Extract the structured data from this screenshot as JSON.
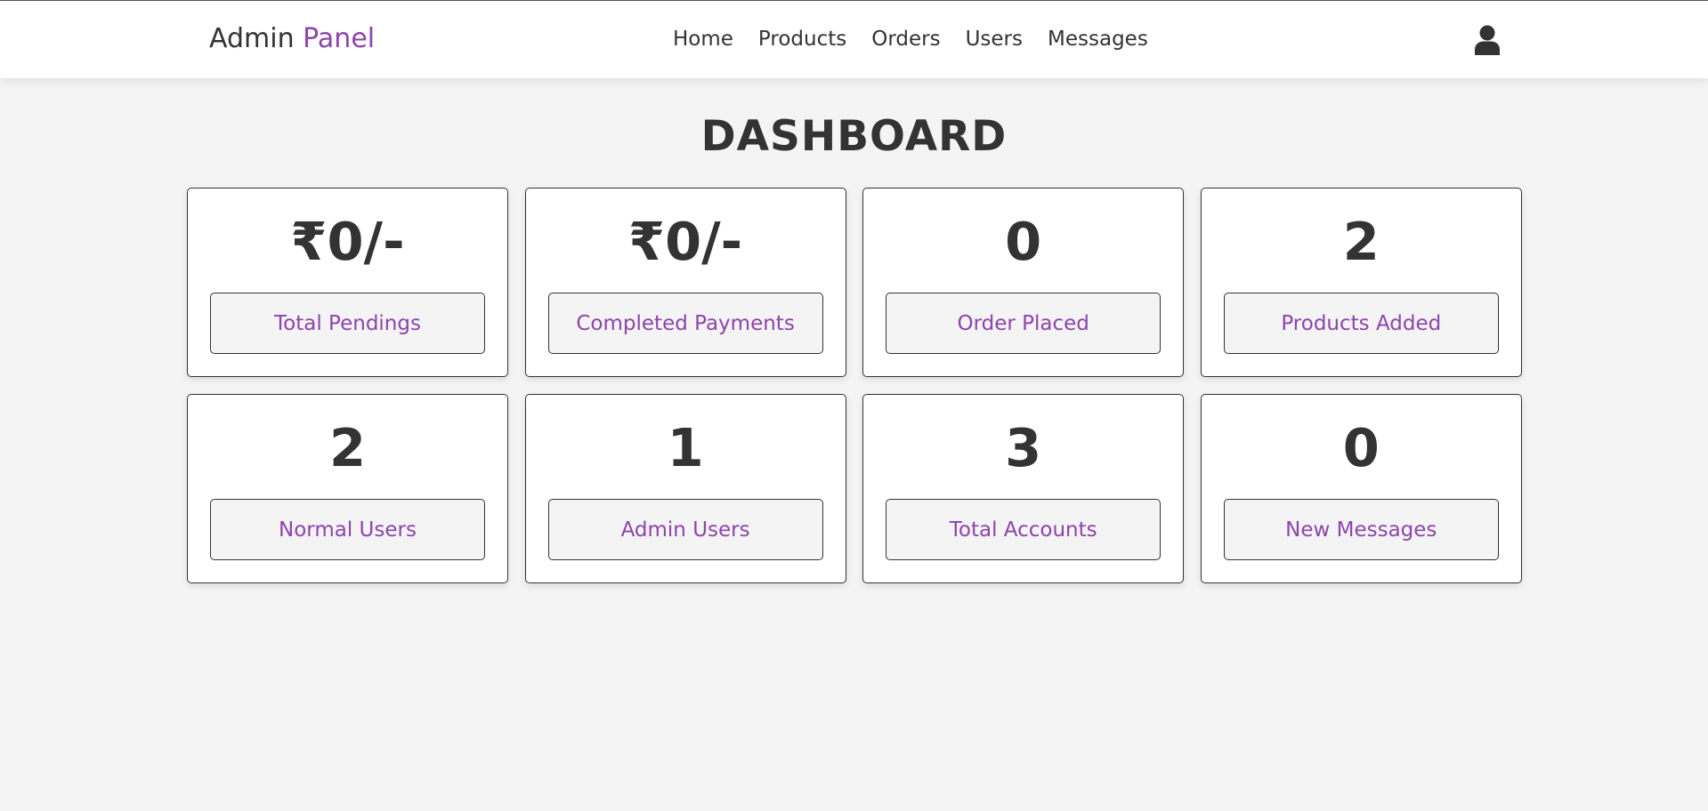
{
  "header": {
    "logo_main": "Admin",
    "logo_accent": "Panel",
    "nav": [
      "Home",
      "Products",
      "Orders",
      "Users",
      "Messages"
    ],
    "user_icon": "user-icon"
  },
  "page_title": "DASHBOARD",
  "accent_color": "#8e44ad",
  "cards": [
    {
      "value": "₹0/-",
      "label": "Total Pendings"
    },
    {
      "value": "₹0/-",
      "label": "Completed Payments"
    },
    {
      "value": "0",
      "label": "Order Placed"
    },
    {
      "value": "2",
      "label": "Products Added"
    },
    {
      "value": "2",
      "label": "Normal Users"
    },
    {
      "value": "1",
      "label": "Admin Users"
    },
    {
      "value": "3",
      "label": "Total Accounts"
    },
    {
      "value": "0",
      "label": "New Messages"
    }
  ]
}
